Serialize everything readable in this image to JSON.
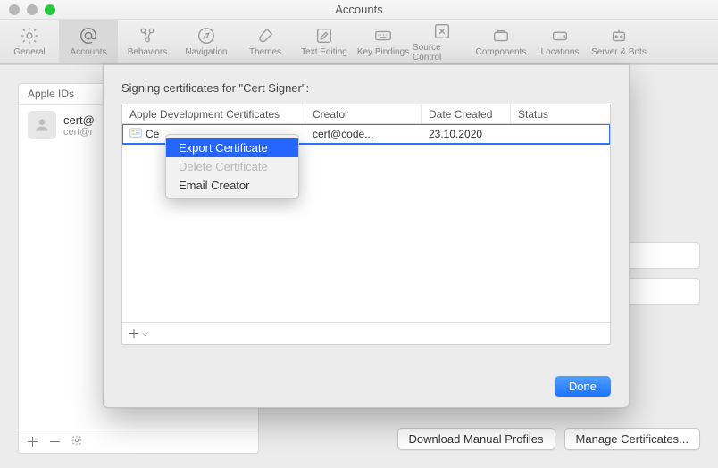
{
  "window": {
    "title": "Accounts"
  },
  "toolbar": [
    {
      "id": "general",
      "label": "General"
    },
    {
      "id": "accounts",
      "label": "Accounts",
      "selected": true
    },
    {
      "id": "behaviors",
      "label": "Behaviors"
    },
    {
      "id": "navigation",
      "label": "Navigation"
    },
    {
      "id": "themes",
      "label": "Themes"
    },
    {
      "id": "text-editing",
      "label": "Text Editing"
    },
    {
      "id": "key-bindings",
      "label": "Key Bindings"
    },
    {
      "id": "source-control",
      "label": "Source Control"
    },
    {
      "id": "components",
      "label": "Components"
    },
    {
      "id": "locations",
      "label": "Locations"
    },
    {
      "id": "server-bots",
      "label": "Server & Bots"
    }
  ],
  "sidebar": {
    "header": "Apple IDs",
    "account": {
      "line1": "cert@",
      "line2": "cert@r"
    }
  },
  "rightpane": {
    "buttons": {
      "download": "Download Manual Profiles",
      "manage": "Manage Certificates..."
    }
  },
  "sheet": {
    "title": "Signing certificates for \"Cert Signer\":",
    "columns": {
      "c1": "Apple Development Certificates",
      "c2": "Creator",
      "c3": "Date Created",
      "c4": "Status"
    },
    "row": {
      "name": "Ce",
      "creator": "cert@code...",
      "date": "23.10.2020",
      "status": ""
    },
    "done": "Done"
  },
  "context_menu": {
    "items": [
      {
        "id": "export",
        "label": "Export Certificate",
        "hover": true
      },
      {
        "id": "delete",
        "label": "Delete Certificate",
        "disabled": true
      },
      {
        "id": "email",
        "label": "Email Creator"
      }
    ]
  }
}
